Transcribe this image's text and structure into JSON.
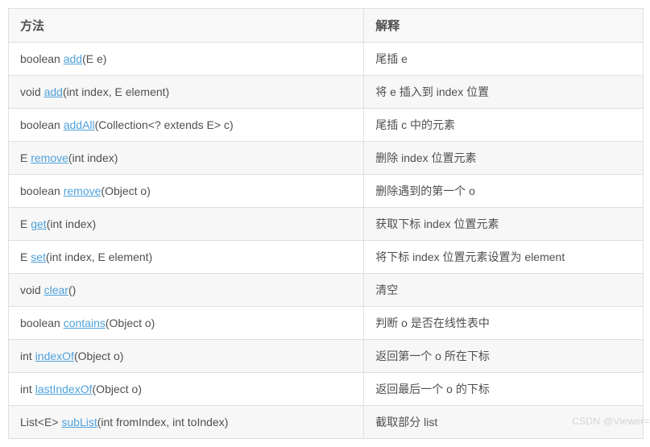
{
  "headers": {
    "method": "方法",
    "desc": "解释"
  },
  "rows": [
    {
      "pre": "boolean ",
      "link": "add",
      "post": "(E e)",
      "desc": "尾插 e"
    },
    {
      "pre": "void ",
      "link": "add",
      "post": "(int index, E element)",
      "desc": "将 e 插入到 index 位置"
    },
    {
      "pre": "boolean ",
      "link": "addAll",
      "post": "(Collection<? extends E> c)",
      "desc": "尾插 c 中的元素"
    },
    {
      "pre": "E ",
      "link": "remove",
      "post": "(int index)",
      "desc": "删除 index 位置元素"
    },
    {
      "pre": "boolean ",
      "link": "remove",
      "post": "(Object o)",
      "desc": "删除遇到的第一个 o"
    },
    {
      "pre": "E ",
      "link": "get",
      "post": "(int index)",
      "desc": "获取下标 index 位置元素"
    },
    {
      "pre": "E ",
      "link": "set",
      "post": "(int index, E element)",
      "desc": "将下标 index 位置元素设置为 element"
    },
    {
      "pre": "void ",
      "link": "clear",
      "post": "()",
      "desc": "清空"
    },
    {
      "pre": "boolean ",
      "link": "contains",
      "post": "(Object o)",
      "desc": "判断 o 是否在线性表中"
    },
    {
      "pre": "int ",
      "link": "indexOf",
      "post": "(Object o)",
      "desc": "返回第一个 o 所在下标"
    },
    {
      "pre": "int ",
      "link": "lastIndexOf",
      "post": "(Object o)",
      "desc": "返回最后一个 o 的下标"
    },
    {
      "pre": "List<E> ",
      "link": "subList",
      "post": "(int fromIndex, int toIndex)",
      "desc": "截取部分 list"
    }
  ],
  "watermark": "CSDN @Viewer="
}
